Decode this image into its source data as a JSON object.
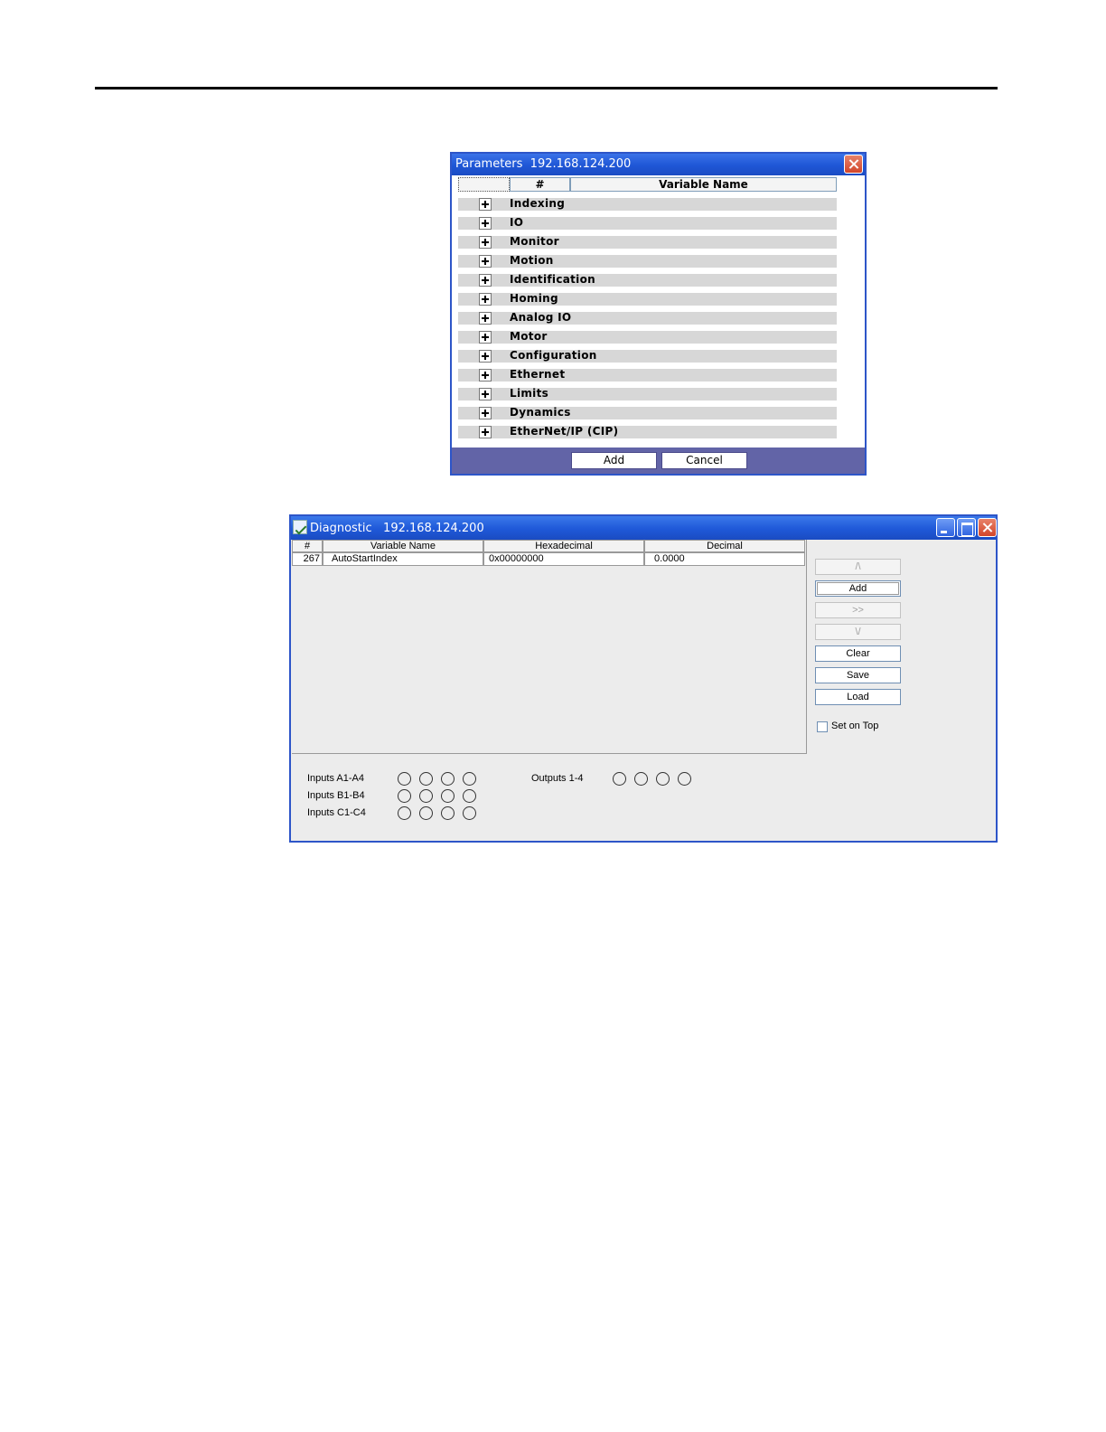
{
  "parameters_dialog": {
    "title": "Parameters  192.168.124.200",
    "columns": {
      "number": "#",
      "variable_name": "Variable Name"
    },
    "groups": [
      "Indexing",
      "IO",
      "Monitor",
      "Motion",
      "Identification",
      "Homing",
      "Analog IO",
      "Motor",
      "Configuration",
      "Ethernet",
      "Limits",
      "Dynamics",
      "EtherNet/IP (CIP)"
    ],
    "buttons": {
      "add": "Add",
      "cancel": "Cancel"
    }
  },
  "diagnostic_window": {
    "title": "Diagnostic   192.168.124.200",
    "columns": [
      "#",
      "Variable Name",
      "Hexadecimal",
      "Decimal"
    ],
    "rows": [
      {
        "number": "267",
        "variable_name": "AutoStartIndex",
        "hexadecimal": "0x00000000",
        "decimal": "0.0000"
      }
    ],
    "buttons": {
      "up": "/\\",
      "add": "Add",
      "forward": ">>",
      "down": "\\/",
      "clear": "Clear",
      "save": "Save",
      "load": "Load"
    },
    "set_on_top": {
      "label": "Set on Top",
      "checked": false
    },
    "io": {
      "inputs_a": "Inputs A1-A4",
      "inputs_b": "Inputs B1-B4",
      "inputs_c": "Inputs C1-C4",
      "outputs": "Outputs 1-4"
    }
  }
}
